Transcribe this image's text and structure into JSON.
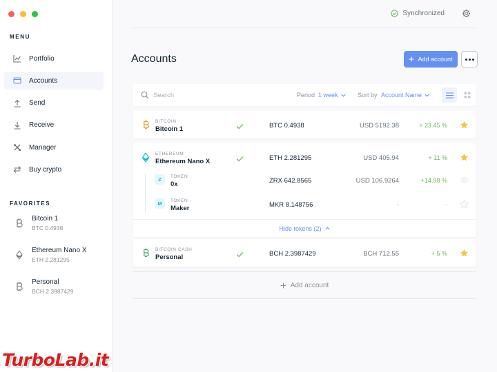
{
  "colors": {
    "accent": "#6490f1",
    "positive": "#66be54",
    "star": "#f6c445",
    "bitcoin": "#f7931a",
    "ethereum": "#0ebdcd",
    "bitcoin_cash": "#3ca569",
    "traffic_close": "#fd5f57",
    "traffic_min": "#fdbc2e",
    "traffic_max": "#28c840",
    "watermark": "#d91f1f"
  },
  "sidebar": {
    "menu_title": "MENU",
    "menu": [
      {
        "label": "Portfolio",
        "icon": "chart-line-icon"
      },
      {
        "label": "Accounts",
        "icon": "wallet-icon"
      },
      {
        "label": "Send",
        "icon": "arrow-up-icon"
      },
      {
        "label": "Receive",
        "icon": "arrow-down-icon"
      },
      {
        "label": "Manager",
        "icon": "tools-icon"
      },
      {
        "label": "Buy crypto",
        "icon": "exchange-icon"
      }
    ],
    "favorites_title": "FAVORITES",
    "favorites": [
      {
        "name": "Bitcoin 1",
        "balance": "BTC 0.4938",
        "icon": "bitcoin-icon"
      },
      {
        "name": "Ethereum Nano X",
        "balance": "ETH 2.281295",
        "icon": "ethereum-icon"
      },
      {
        "name": "Personal",
        "balance": "BCH 2.3987429",
        "icon": "bitcoin-cash-icon"
      }
    ]
  },
  "topbar": {
    "sync_status": "Synchronized"
  },
  "page": {
    "title": "Accounts",
    "add_button": "Add account",
    "add_account_link": "Add account"
  },
  "filters": {
    "search_placeholder": "Search",
    "period_label": "Period",
    "period_value": "1 week",
    "sort_label": "Sort by",
    "sort_value": "Account Name"
  },
  "accounts": [
    {
      "ticker": "BITCOIN",
      "name": "Bitcoin 1",
      "balance": "BTC 0.4938",
      "countervalue": "USD 5192.38",
      "change": "+ 23.45 %",
      "starred": true
    },
    {
      "ticker": "ETHEREUM",
      "name": "Ethereum Nano X",
      "balance": "ETH 2.281295",
      "countervalue": "USD 405.94",
      "change": "+ 11 %",
      "starred": true,
      "tokens": [
        {
          "badge": "Z",
          "ticker": "TOKEN",
          "name": "0x",
          "balance": "ZRX 642.8565",
          "countervalue": "USD 106.9264",
          "change": "+14.98 %",
          "starred": false
        },
        {
          "badge": "M",
          "ticker": "TOKEN",
          "name": "Maker",
          "balance": "MKR 8.148756",
          "countervalue": "-",
          "change": "-",
          "starred": false
        }
      ],
      "hide_tokens": "Hide tokens (2)"
    },
    {
      "ticker": "BITCOIN CASH",
      "name": "Personal",
      "balance": "BCH 2.3987429",
      "countervalue": "BCH 712.55",
      "change": "+ 5 %",
      "starred": true
    }
  ],
  "watermark": "TurboLab.it"
}
